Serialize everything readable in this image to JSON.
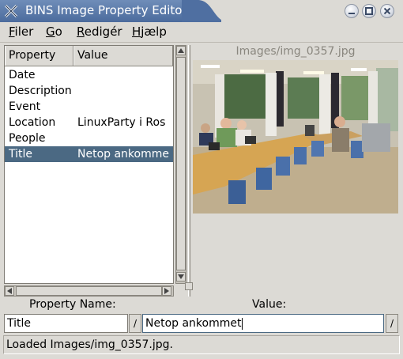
{
  "window": {
    "title": "BINS Image Property Editor"
  },
  "menu": {
    "items": [
      {
        "label": "Filer",
        "accel": "F",
        "rest": "iler"
      },
      {
        "label": "Go",
        "accel": "G",
        "rest": "o"
      },
      {
        "label": "Redigér",
        "accel": "R",
        "rest": "edigér"
      },
      {
        "label": "Hjælp",
        "accel": "H",
        "rest": "jælp"
      }
    ]
  },
  "properties": {
    "columns": [
      "Property",
      "Value"
    ],
    "rows": [
      {
        "property": "Date",
        "value": ""
      },
      {
        "property": "Description",
        "value": ""
      },
      {
        "property": "Event",
        "value": ""
      },
      {
        "property": "Location",
        "value": "LinuxParty i Ros"
      },
      {
        "property": "People",
        "value": ""
      },
      {
        "property": "Title",
        "value": "Netop ankomme"
      }
    ],
    "selected_index": 5
  },
  "image": {
    "caption": "Images/img_0357.jpg"
  },
  "editor": {
    "name_label": "Property Name:",
    "value_label": "Value:",
    "name_value": "Title",
    "value_value": "Netop ankommet",
    "button_glyph": "/"
  },
  "status": {
    "text": "Loaded Images/img_0357.jpg."
  },
  "colors": {
    "selection": "#4b6983",
    "titlebar": "#5a7aac"
  }
}
